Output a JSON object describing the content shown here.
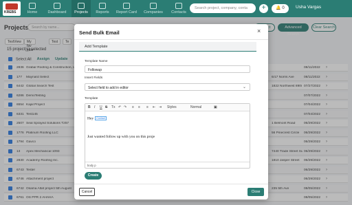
{
  "topbar": {
    "logo_text": "KREBS",
    "nav": [
      {
        "label": "Home",
        "icon": "home-icon"
      },
      {
        "label": "Dashboard",
        "icon": "dashboard-icon"
      },
      {
        "label": "Projects",
        "icon": "projects-icon"
      },
      {
        "label": "Reports",
        "icon": "reports-icon"
      },
      {
        "label": "Report Card",
        "icon": "report-card-icon"
      },
      {
        "label": "Companies",
        "icon": "companies-icon"
      },
      {
        "label": "Contacts",
        "icon": "contacts-icon"
      }
    ],
    "search_placeholder": "Search project, company, conta",
    "plus": "+",
    "bell": "🔔 0",
    "user": "Usha Vargas"
  },
  "page": {
    "title": "Projects",
    "search_placeholder": "Search by name...",
    "buttons": [
      "Project",
      "Advanced Search",
      "Clear Search"
    ],
    "filters": [
      "TestView",
      "My fav jobs",
      "Test",
      "Te"
    ],
    "selected_count": "15 project(s) selected",
    "select_all": "Select All",
    "assign": "Assign",
    "update": "Update"
  },
  "rows": [
    {
      "id": "2836",
      "name": "Grabar Roofing & Construction, LLC",
      "addr": "",
      "date": "08/11/2022"
    },
    {
      "id": "177",
      "name": "Maynard Select",
      "addr": "6/17 Norris Ave",
      "date": "08/11/2022"
    },
    {
      "id": "6442",
      "name": "Global Search Test",
      "addr": "1822 Northwest 89th Avenue",
      "date": "07/27/2022"
    },
    {
      "id": "6286",
      "name": "DemoTesting",
      "addr": "",
      "date": "07/07/2022"
    },
    {
      "id": "6554",
      "name": "Kajal Project",
      "addr": "",
      "date": "07/04/2022"
    },
    {
      "id": "6331",
      "name": "Test145",
      "addr": "",
      "date": "07/04/2022"
    },
    {
      "id": "2507",
      "name": "Seal Sprayed Solutions T257",
      "addr": "1 Belmont Road",
      "date": "06/29/2022"
    },
    {
      "id": "1776",
      "name": "Platinum Roofing LLC",
      "addr": "56 Pinecrest Circle",
      "date": "06/29/2022"
    },
    {
      "id": "1794",
      "name": "Gavco",
      "addr": "",
      "date": "06/29/2022"
    },
    {
      "id": "13",
      "name": "Apex Mechanical 1093",
      "addr": "7440 Trade Street Suite A",
      "date": "06/29/2022"
    },
    {
      "id": "2830",
      "name": "Academy Roofing Inc.",
      "addr": "1810 Jasper Street",
      "date": "06/29/2022"
    },
    {
      "id": "6743",
      "name": "Tester",
      "addr": "",
      "date": "06/29/2022"
    },
    {
      "id": "6746",
      "name": "Attachment project",
      "addr": "",
      "date": "06/29/2022"
    },
    {
      "id": "6742",
      "name": "Osama Altaf project 5th August",
      "addr": "235 5th Ave",
      "date": "08/05/2022"
    },
    {
      "id": "6761",
      "name": "OS PPR 2 AHAHA",
      "addr": "",
      "date": "08/05/2022"
    }
  ],
  "modal": {
    "title": "Send Bulk Email",
    "close_x": "×",
    "tab": "Add Template",
    "template_name_label": "Template Name",
    "template_name_value": "Followup",
    "insert_fields_label": "Insert Fields",
    "insert_fields_value": "Select field to add in editor",
    "template_label": "Template",
    "editor": {
      "toolbar": [
        "B",
        "I",
        "U",
        "S",
        "Tx",
        "↶",
        "↷",
        "≡",
        "≡",
        "≡",
        "⇤",
        "⇥",
        "Styles",
        "Normal",
        "▣"
      ],
      "greeting": "Hey",
      "tag": "Contact",
      "line2": "Just wanted follow up with you on this proje",
      "status": "body  p"
    },
    "float_icon": "↻",
    "create": "Create",
    "cancel": "Cancel",
    "close": "Close"
  },
  "colors": {
    "brand": "#2b7d74",
    "checkbox": "#2a7ae2"
  }
}
